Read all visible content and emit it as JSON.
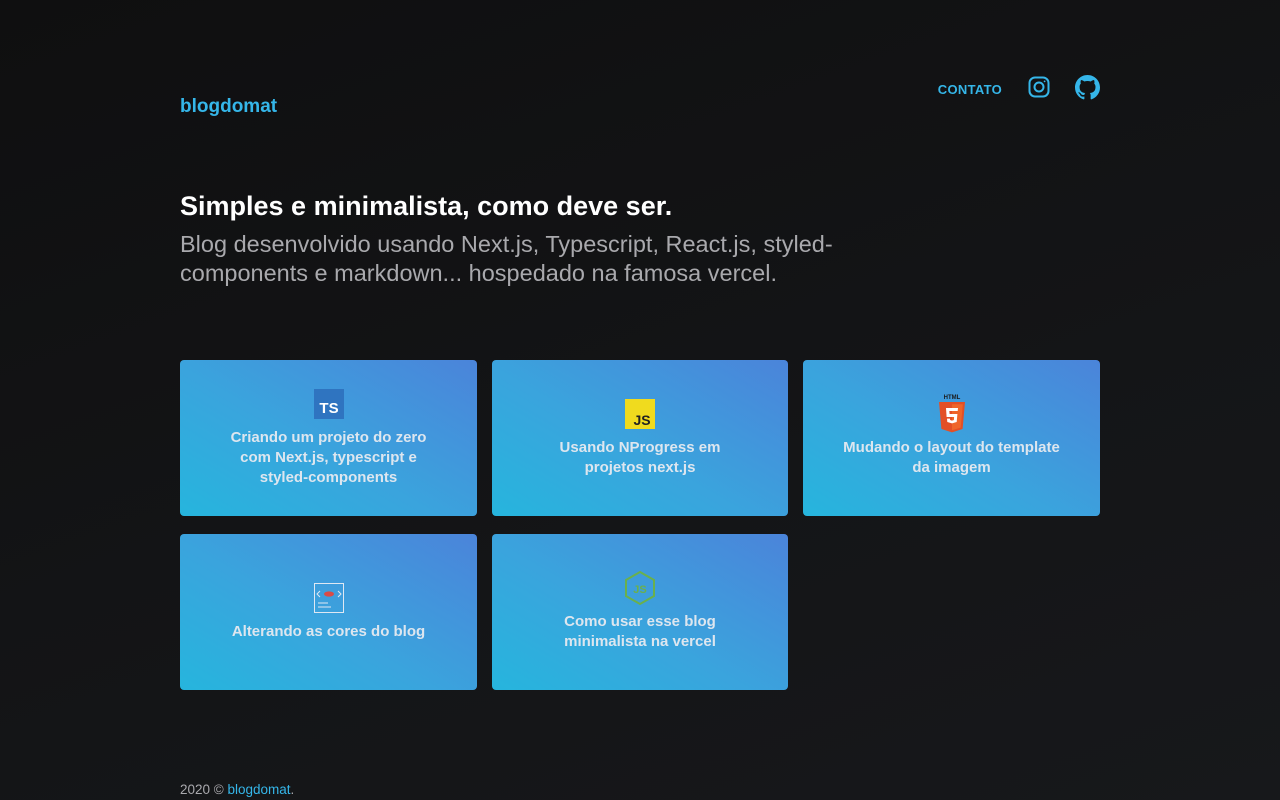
{
  "header": {
    "logo": "blogdomat",
    "nav_contact": "CONTATO",
    "instagram_icon": "instagram-icon",
    "github_icon": "github-icon"
  },
  "hero": {
    "title": "Simples e minimalista, como deve ser.",
    "description": "Blog desenvolvido usando Next.js, Typescript, React.js, styled-components e markdown... hospedado na famosa vercel."
  },
  "posts": [
    {
      "title": "Criando um projeto do zero com Next.js, typescript e styled-components",
      "icon": "typescript-icon",
      "icon_text": "TS"
    },
    {
      "title": "Usando NProgress em projetos next.js",
      "icon": "javascript-icon",
      "icon_text": "JS"
    },
    {
      "title": "Mudando o layout do template da imagem",
      "icon": "html5-icon",
      "icon_text": "HTML"
    },
    {
      "title": "Alterando as cores do blog",
      "icon": "styled-components-icon"
    },
    {
      "title": "Como usar esse blog minimalista na vercel",
      "icon": "nodejs-icon",
      "icon_text": "JS"
    }
  ],
  "footer": {
    "year": "2020 ©",
    "link": "blogdomat",
    "suffix": "."
  },
  "colors": {
    "accent": "#35b6e9",
    "background": "#121314",
    "card_gradient_start": "#26b5dd",
    "card_gradient_end": "#4b84da"
  }
}
